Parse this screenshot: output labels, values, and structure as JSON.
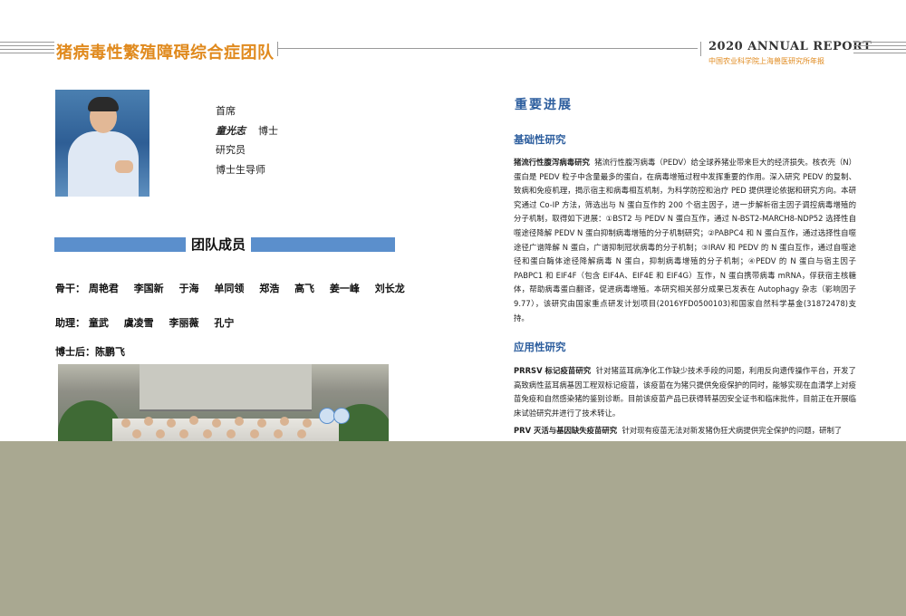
{
  "header": {
    "title": "猪病毒性繁殖障碍综合症团队",
    "report": "2020 ANNUAL REPORT",
    "subtitle": "中国农业科学院上海兽医研究所年报"
  },
  "profile": {
    "role": "首席",
    "name": "童光志",
    "degree": "博士",
    "title": "研究员",
    "supervisor": "博士生导师"
  },
  "team": {
    "heading": "团队成员",
    "core_label": "骨干：",
    "core": [
      "周艳君",
      "李国新",
      "于海",
      "单同领",
      "郑浩",
      "高飞",
      "姜一峰",
      "刘长龙"
    ],
    "assistant_label": "助理：",
    "assistants": [
      "童武",
      "虞凌雪",
      "李丽薇",
      "孔宁"
    ],
    "postdoc_label": "博士后：",
    "postdocs": [
      "陈鹏飞"
    ]
  },
  "progress": {
    "heading": "重要进展",
    "basic_heading": "基础性研究",
    "basic_lead": "猪流行性腹泻病毒研究",
    "basic_text": "猪流行性腹泻病毒（PEDV）给全球养猪业带来巨大的经济损失。核衣壳（N）蛋白是 PEDV 粒子中含量最多的蛋白，在病毒增殖过程中发挥重要的作用。深入研究 PEDV 的复制、致病和免疫机理，揭示宿主和病毒相互机制，为科学防控和治疗 PED 提供理论依据和研究方向。本研究通过 Co-IP 方法，筛选出与 N 蛋白互作的 200 个宿主因子，进一步解析宿主因子调控病毒增殖的分子机制，取得如下进展：①BST2 与 PEDV N 蛋白互作，通过 N-BST2-MARCH8-NDP52 选择性自噬途径降解 PEDV N 蛋白抑制病毒增殖的分子机制研究；②PABPC4 和 N 蛋白互作，通过选择性自噬途径广谱降解 N 蛋白，广谱抑制冠状病毒的分子机制；③IRAV 和 PEDV 的 N 蛋白互作，通过自噬途径和蛋白酶体途径降解病毒 N 蛋白，抑制病毒增殖的分子机制；④PEDV 的 N 蛋白与宿主因子 PABPC1 和 EIF4F（包含 EIF4A、EIF4E 和 EIF4G）互作，N 蛋白携带病毒 mRNA，俘获宿主核糖体，帮助病毒蛋白翻译，促进病毒增殖。本研究相关部分成果已发表在 Autophagy 杂志（影响因子 9.77），该研究由国家重点研发计划项目(2016YFD0500103)和国家自然科学基金(31872478)支持。",
    "applied_heading": "应用性研究",
    "applied_lead1": "PRRSV 标记疫苗研究",
    "applied_text1": "针对猪蓝耳病净化工作缺少技术手段的问题，利用反向遗传操作平台，开发了高致病性蓝耳病基因工程双标记疫苗，该疫苗在为猪只提供免疫保护的同时，能够实现在血清学上对疫苗免疫和自然感染猪的鉴别诊断。目前该疫苗产品已获得转基因安全证书和临床批件，目前正在开展临床试验研究并进行了技术转让。",
    "applied_lead2": "PRV 灭活与基因缺失疫苗研究",
    "applied_text2": "针对现有疫苗无法对新发猪伪狂犬病提供完全保护的问题，研制了"
  }
}
